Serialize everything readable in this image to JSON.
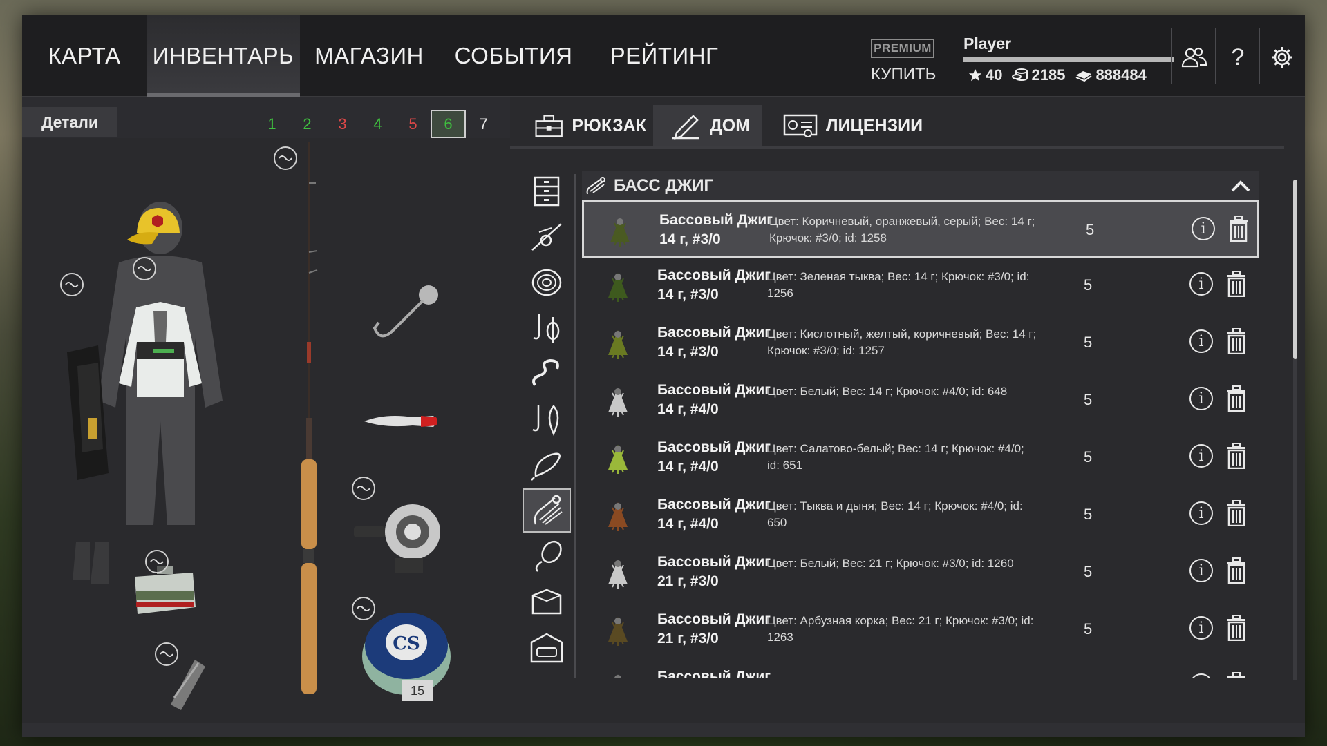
{
  "nav": {
    "items": [
      {
        "label": "КАРТА"
      },
      {
        "label": "ИНВЕНТАРЬ"
      },
      {
        "label": "МАГАЗИН"
      },
      {
        "label": "СОБЫТИЯ"
      },
      {
        "label": "РЕЙТИНГ"
      }
    ],
    "active": "ИНВЕНТАРЬ"
  },
  "premium": {
    "badge": "PREMIUM",
    "buy": "КУПИТЬ"
  },
  "player": {
    "name": "Player",
    "xp_fraction": 1.0,
    "stars": "40",
    "silver": "2185",
    "gold": "888484"
  },
  "top_icons": [
    "friends-icon",
    "help-icon",
    "settings-icon"
  ],
  "help_glyph": "?",
  "left": {
    "tab": "Детали",
    "slots": [
      {
        "label": "1",
        "color": "#3fbf3f"
      },
      {
        "label": "2",
        "color": "#3fbf3f"
      },
      {
        "label": "3",
        "color": "#e04848"
      },
      {
        "label": "4",
        "color": "#3fbf3f"
      },
      {
        "label": "5",
        "color": "#e04848"
      },
      {
        "label": "6",
        "color": "#3fbf3f"
      },
      {
        "label": "7",
        "color": "#e8e8e8"
      }
    ],
    "selected_slot": "6",
    "line_count": "15"
  },
  "right": {
    "tabs": [
      {
        "label": "РЮКЗАК",
        "icon": "toolbox-icon"
      },
      {
        "label": "ДОМ",
        "icon": "house-pen-icon"
      },
      {
        "label": "ЛИЦЕНЗИИ",
        "icon": "license-icon"
      }
    ],
    "active_tab": "ДОМ",
    "categories": [
      "drawer-icon",
      "rod-reel-icon",
      "line-spool-icon",
      "hook-float-icon",
      "worm-icon",
      "hook-fish-icon",
      "lure-icon",
      "jig-icon",
      "spoon-icon",
      "box-icon",
      "car-icon"
    ],
    "selected_category": 7,
    "section_title": "БАСС ДЖИГ",
    "items": [
      {
        "name": "Бассовый Джиг",
        "size": "14 г, #3/0",
        "desc": "Цвет: Коричневый, оранжевый, серый; Вес: 14 г; Крючок: #3/0; id: 1258",
        "qty": "5",
        "color": "#4a5a22",
        "selected": true
      },
      {
        "name": "Бассовый Джиг",
        "size": "14 г, #3/0",
        "desc": "Цвет: Зеленая тыква; Вес: 14 г; Крючок: #3/0; id: 1256",
        "qty": "5",
        "color": "#3e5a1e"
      },
      {
        "name": "Бассовый Джиг",
        "size": "14 г, #3/0",
        "desc": "Цвет: Кислотный, желтый, коричневый; Вес: 14 г; Крючок: #3/0; id: 1257",
        "qty": "5",
        "color": "#6a7a22"
      },
      {
        "name": "Бассовый Джиг",
        "size": "14 г, #4/0",
        "desc": "Цвет: Белый; Вес: 14 г; Крючок: #4/0; id: 648",
        "qty": "5",
        "color": "#c8c8c8"
      },
      {
        "name": "Бассовый Джиг",
        "size": "14 г, #4/0",
        "desc": "Цвет: Салатово-белый; Вес: 14 г; Крючок: #4/0; id: 651",
        "qty": "5",
        "color": "#9ab83a"
      },
      {
        "name": "Бассовый Джиг",
        "size": "14 г, #4/0",
        "desc": "Цвет: Тыква и дыня; Вес: 14 г; Крючок: #4/0; id: 650",
        "qty": "5",
        "color": "#8a4a22"
      },
      {
        "name": "Бассовый Джиг",
        "size": "21 г, #3/0",
        "desc": "Цвет: Белый; Вес: 21 г; Крючок: #3/0; id: 1260",
        "qty": "5",
        "color": "#c8c8c8"
      },
      {
        "name": "Бассовый Джиг",
        "size": "21 г, #3/0",
        "desc": "Цвет: Арбузная корка; Вес: 21 г; Крючок: #3/0; id: 1263",
        "qty": "5",
        "color": "#5a4a22"
      },
      {
        "name": "Бассовый Джиг",
        "size": "",
        "desc": "",
        "qty": "",
        "color": "#5a5a5a"
      }
    ]
  }
}
